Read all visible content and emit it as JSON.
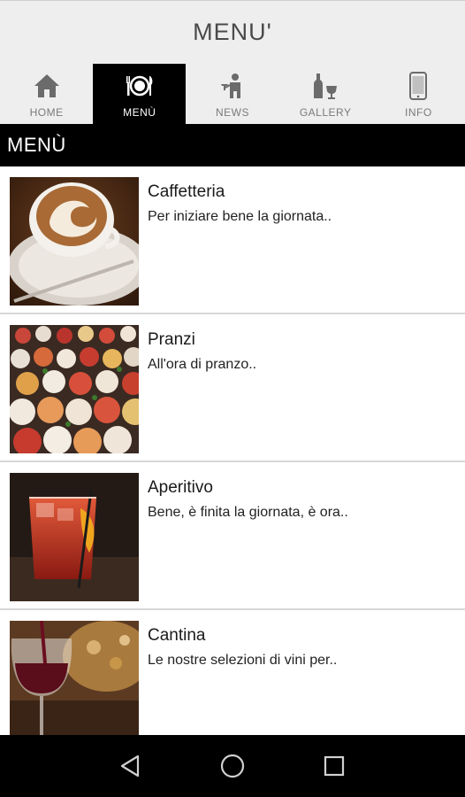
{
  "header": {
    "title": "MENU'"
  },
  "tabs": [
    {
      "label": "HOME",
      "icon": "home-icon",
      "active": false
    },
    {
      "label": "MENÙ",
      "icon": "dining-icon",
      "active": true
    },
    {
      "label": "NEWS",
      "icon": "waiter-icon",
      "active": false
    },
    {
      "label": "GALLERY",
      "icon": "wine-icon",
      "active": false
    },
    {
      "label": "INFO",
      "icon": "phone-icon",
      "active": false
    }
  ],
  "section": {
    "title": "MENÙ"
  },
  "items": [
    {
      "name": "Caffetteria",
      "description": "Per iniziare bene la giornata..",
      "image": "cappuccino-photo"
    },
    {
      "name": "Pranzi",
      "description": "All'ora di pranzo..",
      "image": "canapes-photo"
    },
    {
      "name": "Aperitivo",
      "description": "Bene, è finita la giornata, è ora..",
      "image": "cocktail-photo"
    },
    {
      "name": "Cantina",
      "description": "Le nostre selezioni di vini per..",
      "image": "red-wine-photo"
    }
  ],
  "navbar": {
    "back": "back-icon",
    "home": "home-circle-icon",
    "recents": "recents-icon"
  },
  "colors": {
    "tab_active_bg": "#000000",
    "tab_bg": "#efeeee",
    "section_bg": "#000000"
  }
}
